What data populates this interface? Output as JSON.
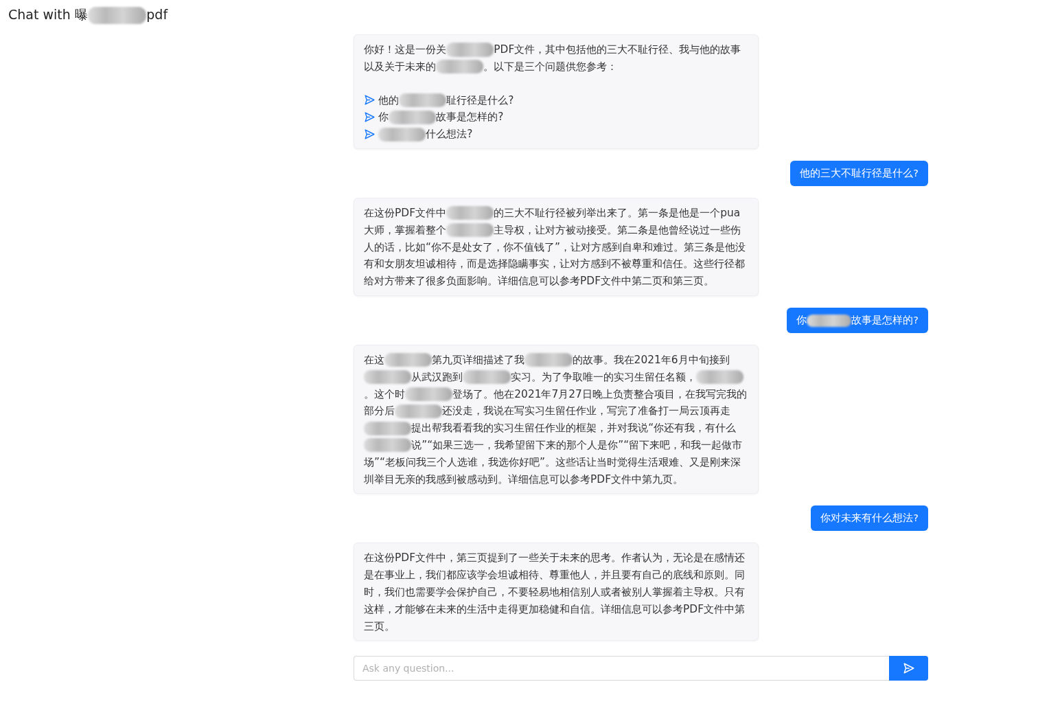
{
  "header": {
    "title": [
      {
        "kind": "text",
        "text": "Chat with 曝"
      },
      {
        "kind": "redacted"
      },
      {
        "kind": "text",
        "text": "pdf"
      }
    ]
  },
  "messages": [
    {
      "kind": "bot",
      "paragraphs": [
        [
          {
            "kind": "text",
            "text": "你好！这是一份关"
          },
          {
            "kind": "redacted"
          },
          {
            "kind": "text",
            "text": "PDF文件，其中包括他的三大不耻行径、我与他的故事以及关于未来的"
          },
          {
            "kind": "redacted"
          },
          {
            "kind": "text",
            "text": "。以下是三个问题供您参考："
          }
        ]
      ],
      "suggestions": [
        [
          {
            "kind": "text",
            "text": "他的"
          },
          {
            "kind": "redacted"
          },
          {
            "kind": "text",
            "text": "耻行径是什么?"
          }
        ],
        [
          {
            "kind": "text",
            "text": "你"
          },
          {
            "kind": "redacted"
          },
          {
            "kind": "text",
            "text": "故事是怎样的?"
          }
        ],
        [
          {
            "kind": "redacted"
          },
          {
            "kind": "text",
            "text": "什么想法?"
          }
        ]
      ]
    },
    {
      "kind": "user",
      "paragraphs": [
        [
          {
            "kind": "text",
            "text": "他的三大不耻行径是什么?"
          }
        ]
      ]
    },
    {
      "kind": "bot",
      "paragraphs": [
        [
          {
            "kind": "text",
            "text": "在这份PDF文件中"
          },
          {
            "kind": "redacted"
          },
          {
            "kind": "text",
            "text": "的三大不耻行径被列举出来了。第一条是他是一个pua大师，掌握着整个"
          },
          {
            "kind": "redacted"
          },
          {
            "kind": "text",
            "text": "主导权，让对方被动接受。第二条是他曾经说过一些伤人的话，比如“你不是处女了，你不值钱了”，让对方感到自卑和难过。第三条是他没有和女朋友坦诚相待，而是选择隐瞒事实，让对方感到不被尊重和信任。这些行径都给对方带来了很多负面影响。详细信息可以参考PDF文件中第二页和第三页。"
          }
        ]
      ]
    },
    {
      "kind": "user",
      "paragraphs": [
        [
          {
            "kind": "text",
            "text": "你"
          },
          {
            "kind": "redacted"
          },
          {
            "kind": "text",
            "text": "故事是怎样的?"
          }
        ]
      ]
    },
    {
      "kind": "bot",
      "paragraphs": [
        [
          {
            "kind": "text",
            "text": "在这"
          },
          {
            "kind": "redacted"
          },
          {
            "kind": "text",
            "text": "第九页详细描述了我"
          },
          {
            "kind": "redacted"
          },
          {
            "kind": "text",
            "text": "的故事。我在2021年6月中旬接到"
          },
          {
            "kind": "redacted"
          },
          {
            "kind": "text",
            "text": "从武汉跑到"
          },
          {
            "kind": "redacted"
          },
          {
            "kind": "text",
            "text": "实习。为了争取唯一的实习生留任名额，"
          },
          {
            "kind": "redacted"
          },
          {
            "kind": "text",
            "text": "。这个时"
          },
          {
            "kind": "redacted"
          },
          {
            "kind": "text",
            "text": "登场了。他在2021年7月27日晚上负责整合项目，在我写完我的部分后"
          },
          {
            "kind": "redacted"
          },
          {
            "kind": "text",
            "text": "还没走，我说在写实习生留任作业，写完了准备打一局云顶再走"
          },
          {
            "kind": "redacted"
          },
          {
            "kind": "text",
            "text": "提出帮我看看我的实习生留任作业的框架，并对我说“你还有我，有什么"
          },
          {
            "kind": "redacted"
          },
          {
            "kind": "text",
            "text": "说”“如果三选一，我希望留下来的那个人是你”“留下来吧，和我一起做市场”“老板问我三个人选谁，我选你好吧”。这些话让当时觉得生活艰难、又是刚来深圳举目无亲的我感到被感动到。详细信息可以参考PDF文件中第九页。"
          }
        ]
      ]
    },
    {
      "kind": "user",
      "paragraphs": [
        [
          {
            "kind": "text",
            "text": "你对未来有什么想法?"
          }
        ]
      ]
    },
    {
      "kind": "bot",
      "paragraphs": [
        [
          {
            "kind": "text",
            "text": "在这份PDF文件中，第三页提到了一些关于未来的思考。作者认为，无论是在感情还是在事业上，我们都应该学会坦诚相待、尊重他人，并且要有自己的底线和原则。同时，我们也需要学会保护自己，不要轻易地相信别人或者被别人掌握着主导权。只有这样，才能够在未来的生活中走得更加稳健和自信。详细信息可以参考PDF文件中第三页。"
          }
        ]
      ]
    }
  ],
  "composer": {
    "placeholder": "Ask any question..."
  }
}
